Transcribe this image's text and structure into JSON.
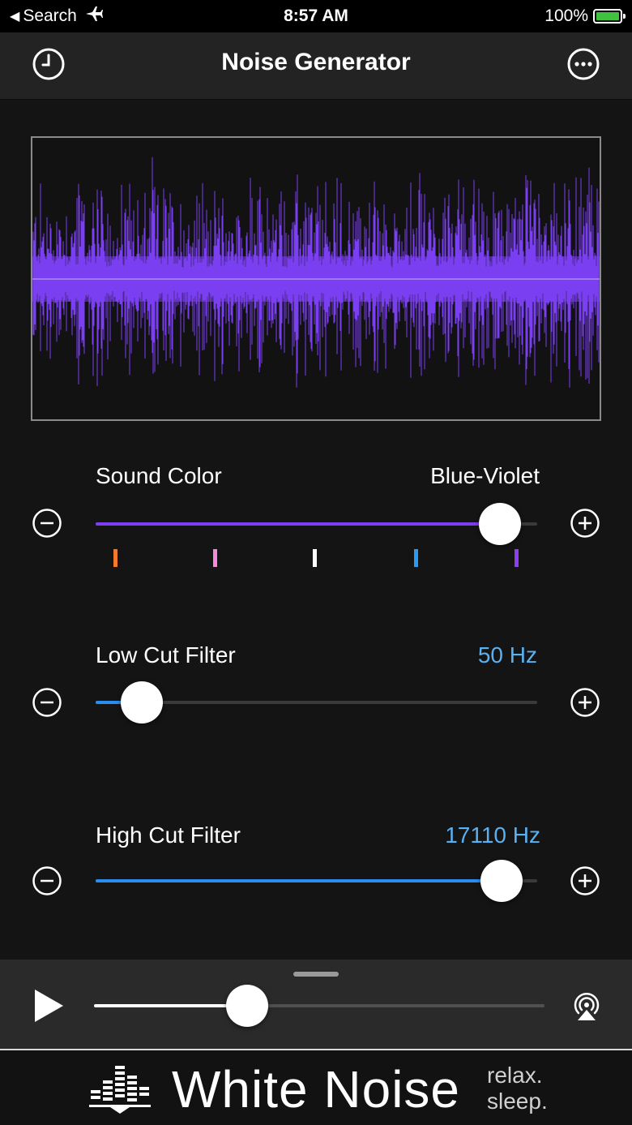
{
  "status": {
    "back_label": "Search",
    "time": "8:57 AM",
    "battery": "100%"
  },
  "nav": {
    "title": "Noise Generator",
    "left_icon": "history-clock-icon",
    "right_icon": "more-ellipsis-icon"
  },
  "waveform": {
    "color": "#7b3ff2"
  },
  "sound_color": {
    "label": "Sound Color",
    "value": "Blue-Violet",
    "position": 0.915,
    "fill_color": "#7b3ff2",
    "ticks": [
      "#f07a2a",
      "#f58ad8",
      "#ffffff",
      "#2a9bf5",
      "#8a3ff0"
    ]
  },
  "low_cut": {
    "label": "Low Cut Filter",
    "value": "50 Hz",
    "position": 0.105,
    "fill_color": "#2b8cf0",
    "value_color": "#5bb0f0"
  },
  "high_cut": {
    "label": "High Cut Filter",
    "value": "17110 Hz",
    "position": 0.92,
    "fill_color": "#2b8cf0",
    "value_color": "#5bb0f0"
  },
  "player": {
    "volume": 0.34,
    "play_icon": "play-icon",
    "airplay_icon": "airplay-icon"
  },
  "banner": {
    "title": "White Noise",
    "tagline_1": "relax.",
    "tagline_2": "sleep."
  }
}
